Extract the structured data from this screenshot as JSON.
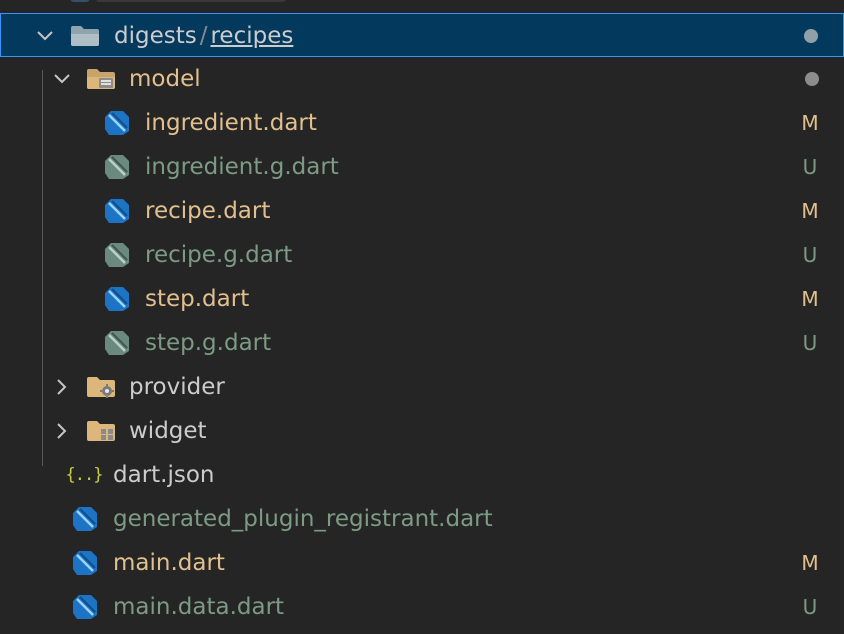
{
  "explorer": {
    "root": {
      "path_parent": "digests",
      "separator": "/",
      "path_child": "recipes",
      "expanded": true,
      "status": "dot"
    },
    "folders": [
      {
        "name": "model",
        "expanded": true,
        "status": "dot",
        "icon": "folder-model-icon"
      },
      {
        "name": "provider",
        "expanded": false,
        "icon": "folder-provider-icon"
      },
      {
        "name": "widget",
        "expanded": false,
        "icon": "folder-widget-icon"
      }
    ],
    "model_files": [
      {
        "name": "ingredient.dart",
        "badge": "M",
        "state": "modified"
      },
      {
        "name": "ingredient.g.dart",
        "badge": "U",
        "state": "untracked"
      },
      {
        "name": "recipe.dart",
        "badge": "M",
        "state": "modified"
      },
      {
        "name": "recipe.g.dart",
        "badge": "U",
        "state": "untracked"
      },
      {
        "name": "step.dart",
        "badge": "M",
        "state": "modified"
      },
      {
        "name": "step.g.dart",
        "badge": "U",
        "state": "untracked"
      }
    ],
    "root_files": [
      {
        "name": "dart.json",
        "badge": "",
        "state": "normal",
        "icon": "json-icon",
        "icon_glyph": "{..}"
      },
      {
        "name": "generated_plugin_registrant.dart",
        "badge": "",
        "state": "untracked-faded",
        "icon": "dart-icon"
      },
      {
        "name": "main.dart",
        "badge": "M",
        "state": "modified",
        "icon": "dart-icon"
      },
      {
        "name": "main.data.dart",
        "badge": "U",
        "state": "untracked",
        "icon": "dart-icon"
      }
    ]
  },
  "colors": {
    "background": "#252526",
    "selection": "#04395e",
    "selection_border": "#3794ff",
    "modified": "#e2c08d",
    "untracked": "#73c991",
    "dart_blue": "#1d74c4",
    "dart_grey": "#6b8a7f",
    "folder": "#dcb67a"
  }
}
